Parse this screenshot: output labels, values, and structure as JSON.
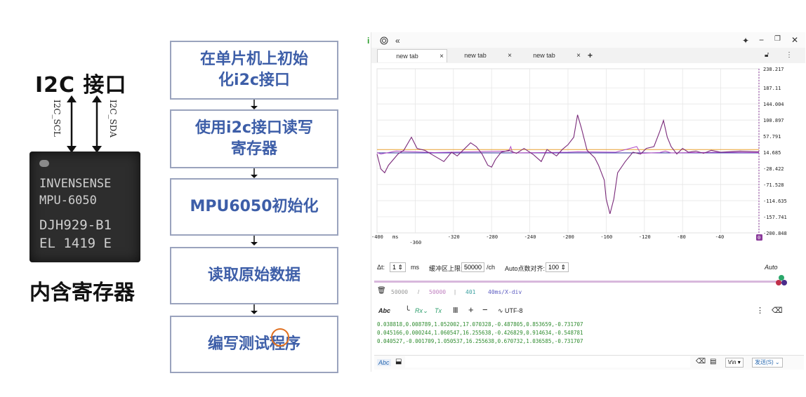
{
  "left": {
    "title": "I2C 接口",
    "pins": [
      "I2C_SCL",
      "I2C_SDA"
    ],
    "chip_lines": [
      "INVENSENSE",
      "MPU-6050",
      "DJH929-B1",
      "EL  1419 E"
    ],
    "caption": "内含寄存器"
  },
  "flow": {
    "steps": [
      "在单片机上初始\n化i2c接口",
      "使用i2c接口读写\n寄存器",
      "MPU6050初始化",
      "读取原始数据",
      "编写测试程序"
    ]
  },
  "window": {
    "title_icons": [
      "info-icon",
      "fingerprint-icon",
      "collapse-icon"
    ],
    "controls": [
      "pin-icon",
      "minimize-icon",
      "restore-icon",
      "close-icon"
    ],
    "tabs": [
      {
        "label": "new tab",
        "close": "×"
      },
      {
        "label": "new tab",
        "close": "×"
      },
      {
        "label": "new tab",
        "close": "×"
      }
    ],
    "add_tab": "+",
    "chart_data": {
      "type": "line",
      "y_ticks": [
        "238.217",
        "187.11",
        "144.004",
        "100.897",
        "57.791",
        "14.685",
        "-28.422",
        "-71.528",
        "-114.635",
        "-157.741",
        "-200.848"
      ],
      "x_ticks": [
        "-400",
        "-360",
        "-320",
        "-280",
        "-240",
        "-200",
        "-160",
        "-120",
        "-80",
        "-40",
        "0"
      ],
      "x_unit": "ms",
      "ylim": [
        -200.848,
        238.217
      ],
      "xlim": [
        -400,
        0
      ],
      "series_colors": [
        "#7a2a7a",
        "#b04ac8",
        "#e8a030",
        "#3a3aa8"
      ]
    },
    "settings": {
      "dt_label": "Δt:",
      "dt_value": "1",
      "dt_unit": "ms",
      "buffer_label": "缓冲区上限:",
      "buffer_value": "50000",
      "buffer_unit": "/ch",
      "auto_label": "Auto点数对齐:",
      "auto_value": "100",
      "auto_mode": "Auto"
    },
    "stats": {
      "a": "50000",
      "sep1": "/",
      "b": "50000",
      "sep2": "|",
      "c": "401",
      "d": "40ms/X-div"
    },
    "rx_toolbar": {
      "abc": "Abc",
      "rx": "Rx",
      "tx": "Tx",
      "plus": "+",
      "minus": "−",
      "encoding": "UTF-8"
    },
    "rx_lines": [
      "0.038818,0.008789,1.052002,17.070328,-0.487805,0.853659,-0.731707",
      "0.045166,0.000244,1.060547,16.255638,-0.426829,0.914634,-0.548781",
      "0.040527,-0.001709,1.050537,16.255638,0.670732,1.036585,-0.731707"
    ],
    "send_bar": {
      "abc": "Abc",
      "line_end": "\\r\\n",
      "send": "发送(S)"
    }
  }
}
